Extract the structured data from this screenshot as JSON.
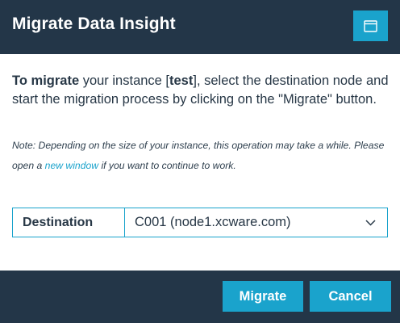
{
  "dialog": {
    "title": "Migrate Data Insight",
    "window_icon": "window-icon"
  },
  "intro": {
    "lead": "To migrate",
    "text_before_instance": " your instance [",
    "instance_name": "test",
    "text_after_instance": "], select the destination node and start the migration process by clicking on the \"Migrate\" button."
  },
  "note": {
    "before_link": "Note: Depending on the size of your instance, this operation may take a while. Please open a ",
    "link_text": "new window",
    "after_link": " if you want to continue to work."
  },
  "destination": {
    "label": "Destination",
    "selected_value": "C001 (node1.xcware.com)",
    "dropdown_icon": "chevron-down-icon"
  },
  "footer": {
    "migrate_label": "Migrate",
    "cancel_label": "Cancel"
  },
  "colors": {
    "header_bg": "#233648",
    "accent": "#1aa3cc",
    "text": "#273746"
  }
}
